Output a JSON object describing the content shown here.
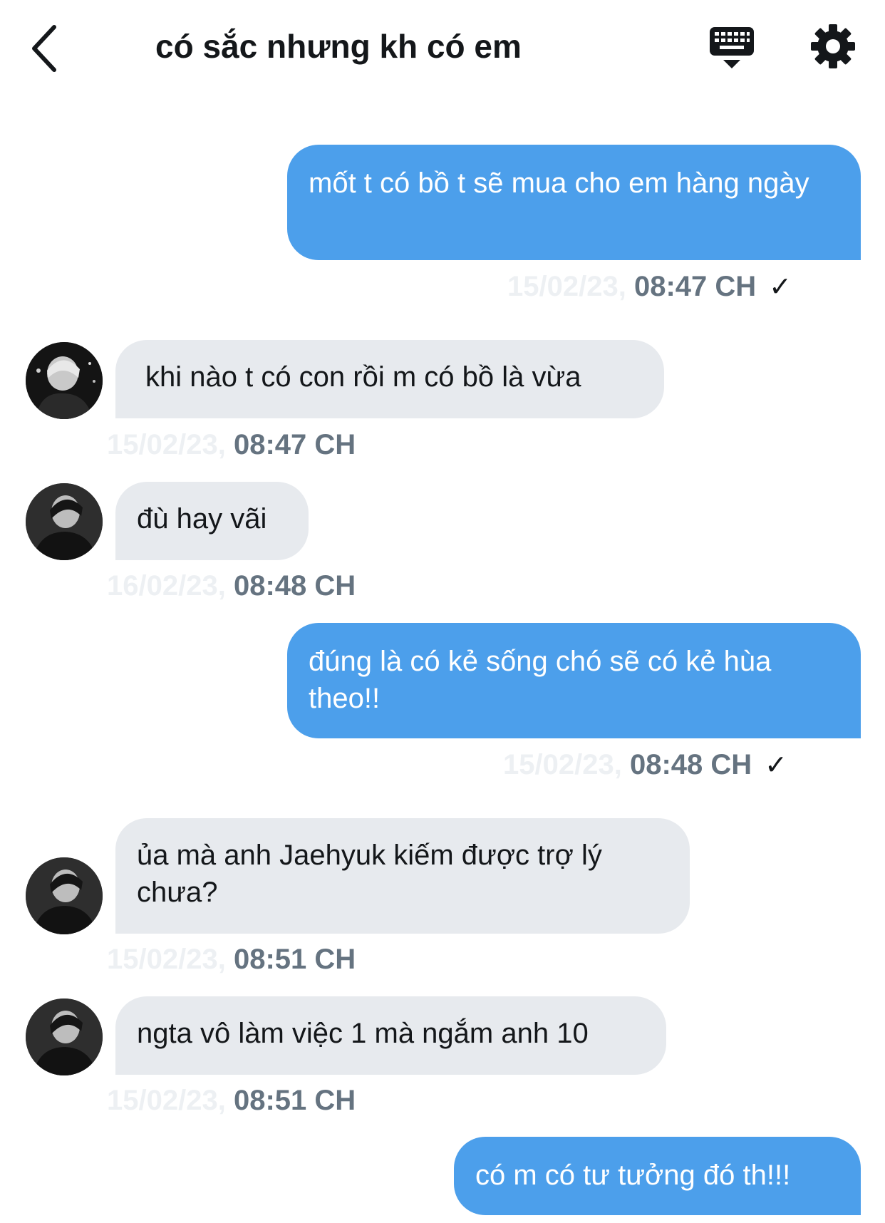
{
  "header": {
    "title": "có sắc nhưng kh có em"
  },
  "icons": {
    "back": "chevron-left-icon",
    "keyboard": "keyboard-icon",
    "settings": "gear-icon"
  },
  "colors": {
    "outgoing_bubble": "#4c9feb",
    "incoming_bubble": "#e7eaee",
    "timestamp": "#657380"
  },
  "messages": [
    {
      "direction": "outgoing",
      "text": "mốt t có bồ t sẽ mua cho em hàng ngày",
      "date": "15/02/23,",
      "time": "08:47 CH",
      "status": "✓"
    },
    {
      "direction": "incoming",
      "text": "khi nào t có con rồi m có bồ là vừa",
      "date": "15/02/23,",
      "time": "08:47 CH"
    },
    {
      "direction": "incoming",
      "text": "đù hay vãi",
      "date": "16/02/23,",
      "time": "08:48 CH"
    },
    {
      "direction": "outgoing",
      "text": "đúng là có kẻ sống chó sẽ có kẻ hùa theo!!",
      "date": "15/02/23,",
      "time": "08:48 CH",
      "status": "✓"
    },
    {
      "direction": "incoming",
      "text": "ủa mà anh Jaehyuk kiếm được trợ lý chưa?",
      "date": "15/02/23,",
      "time": "08:51 CH"
    },
    {
      "direction": "incoming",
      "text": "ngta vô làm việc 1 mà ngắm anh 10",
      "date": "15/02/23,",
      "time": "08:51 CH"
    },
    {
      "direction": "outgoing",
      "text": "có m có tư tưởng đó th!!!"
    }
  ]
}
